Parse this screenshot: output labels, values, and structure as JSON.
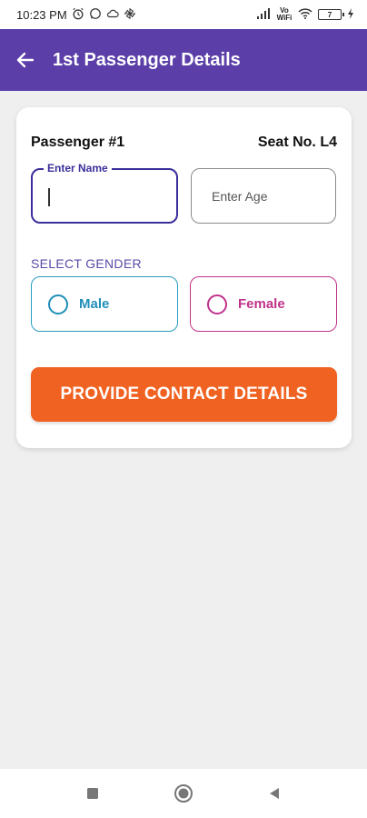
{
  "status_bar": {
    "time": "10:23 PM",
    "network_label": "Vo WiFi",
    "battery_level": "7"
  },
  "app_bar": {
    "title": "1st Passenger Details"
  },
  "form": {
    "passenger_label": "Passenger #1",
    "seat_label": "Seat No. L4",
    "name_field": {
      "label": "Enter Name",
      "value": ""
    },
    "age_field": {
      "placeholder": "Enter Age",
      "value": ""
    },
    "gender_label": "SELECT GENDER",
    "gender_options": [
      {
        "label": "Male",
        "color": "#1f8fb8",
        "selected": false
      },
      {
        "label": "Female",
        "color": "#c0328a",
        "selected": false
      }
    ],
    "cta_label": "PROVIDE CONTACT DETAILS"
  },
  "colors": {
    "app_bar": "#5b3ea8",
    "cta": "#f06221",
    "background": "#efefef"
  }
}
